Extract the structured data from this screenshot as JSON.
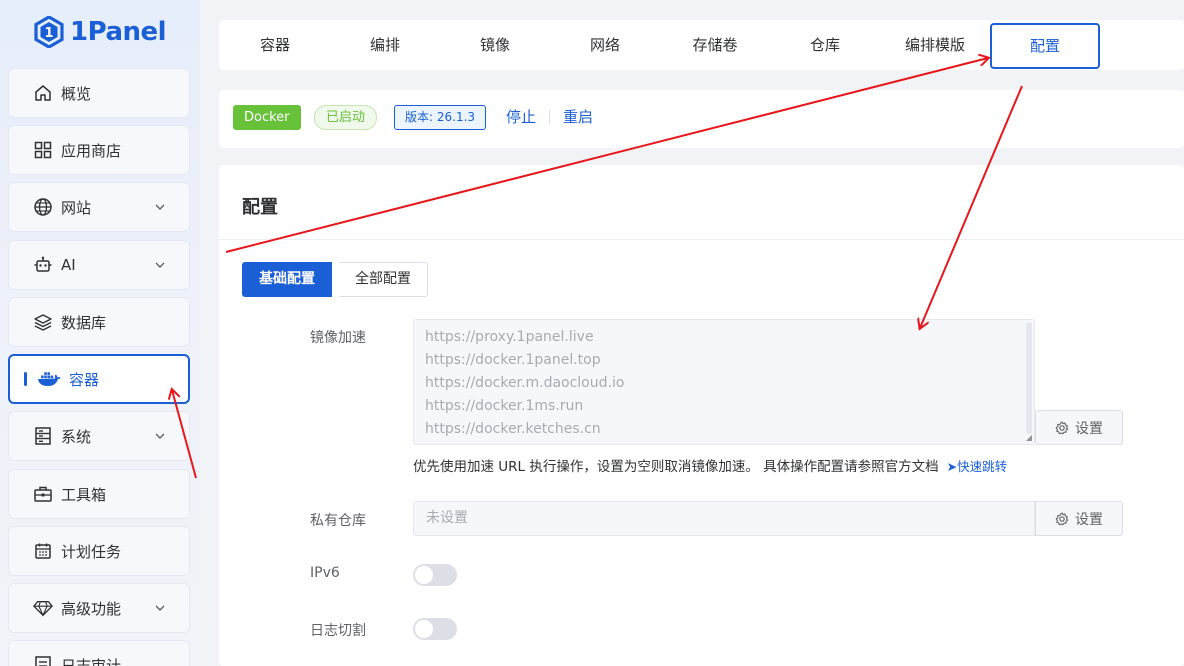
{
  "app": {
    "logo_text": "1Panel"
  },
  "sidebar": {
    "items": [
      {
        "label": "概览",
        "icon": "home-icon"
      },
      {
        "label": "应用商店",
        "icon": "grid-icon"
      },
      {
        "label": "网站",
        "icon": "globe-icon",
        "has_children": true
      },
      {
        "label": "AI",
        "icon": "robot-icon",
        "has_children": true
      },
      {
        "label": "数据库",
        "icon": "layers-icon"
      },
      {
        "label": "容器",
        "icon": "docker-icon",
        "active": true
      },
      {
        "label": "系统",
        "icon": "server-icon",
        "has_children": true
      },
      {
        "label": "工具箱",
        "icon": "toolbox-icon"
      },
      {
        "label": "计划任务",
        "icon": "calendar-icon"
      },
      {
        "label": "高级功能",
        "icon": "diamond-icon",
        "has_children": true
      },
      {
        "label": "日志审计",
        "icon": "log-icon"
      }
    ]
  },
  "tabs": [
    {
      "label": "容器"
    },
    {
      "label": "编排"
    },
    {
      "label": "镜像"
    },
    {
      "label": "网络"
    },
    {
      "label": "存储卷"
    },
    {
      "label": "仓库"
    },
    {
      "label": "编排模版"
    },
    {
      "label": "配置",
      "active": true
    }
  ],
  "status": {
    "service_tag": "Docker",
    "state_tag": "已启动",
    "version_tag": "版本: 26.1.3",
    "stop_label": "停止",
    "restart_label": "重启"
  },
  "config": {
    "title": "配置",
    "segment_basic": "基础配置",
    "segment_all": "全部配置",
    "mirror_label": "镜像加速",
    "mirrors": [
      "https://proxy.1panel.live",
      "https://docker.1panel.top",
      "https://docker.m.daocloud.io",
      "https://docker.1ms.run",
      "https://docker.ketches.cn"
    ],
    "set_label": "设置",
    "mirror_help": "优先使用加速 URL 执行操作，设置为空则取消镜像加速。 具体操作配置请参照官方文档",
    "mirror_help_link": "快速跳转",
    "registry_label": "私有仓库",
    "registry_placeholder": "未设置",
    "ipv6_label": "IPv6",
    "ipv6_enabled": false,
    "log_rotate_label": "日志切割",
    "log_rotate_enabled": false
  },
  "colors": {
    "accent": "#1a5fd6",
    "success": "#67c23a",
    "annotation_arrow": "#e8161b"
  }
}
